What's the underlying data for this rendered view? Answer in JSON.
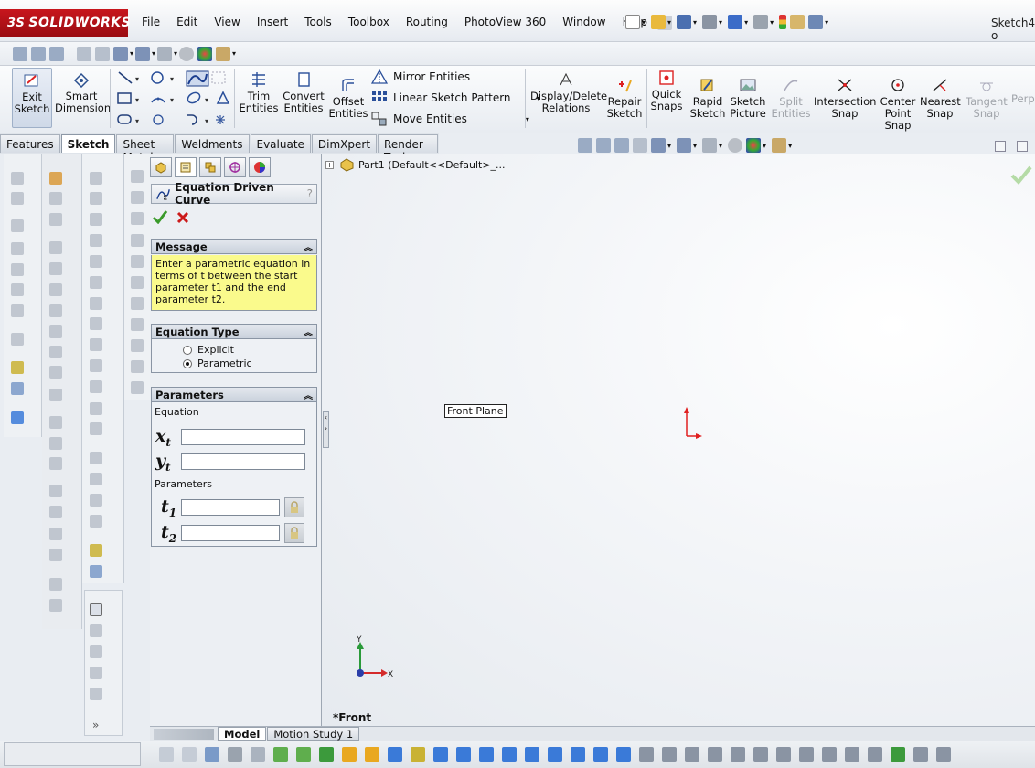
{
  "app": {
    "brand": "SOLIDWORKS",
    "brand_prefix": "3S",
    "document_title": "Sketch4 o"
  },
  "menu": [
    "File",
    "Edit",
    "View",
    "Insert",
    "Tools",
    "Toolbox",
    "Routing",
    "PhotoView 360",
    "Window",
    "Help"
  ],
  "command_manager": {
    "exit_sketch": "Exit Sketch",
    "smart_dimension": "Smart Dimension",
    "trim_entities": "Trim Entities",
    "convert_entities": "Convert Entities",
    "offset_entities": "Offset Entities",
    "mirror_entities": "Mirror Entities",
    "linear_sketch_pattern": "Linear Sketch Pattern",
    "move_entities": "Move Entities",
    "display_delete_relations": "Display/Delete Relations",
    "repair_sketch": "Repair Sketch",
    "quick_snaps": "Quick Snaps",
    "rapid_sketch": "Rapid Sketch",
    "sketch_picture": "Sketch Picture",
    "split_entities": "Split Entities",
    "intersection_snap": "Intersection Snap",
    "center_point_snap": "Center Point Snap",
    "nearest_snap": "Nearest Snap",
    "tangent_snap": "Tangent Snap",
    "perp": "Perp"
  },
  "tabs": [
    "Features",
    "Sketch",
    "Sheet Metal",
    "Weldments",
    "Evaluate",
    "DimXpert",
    "Render Tools"
  ],
  "active_tab": "Sketch",
  "feature_tree": {
    "root": "Part1  (Default<<Default>_..."
  },
  "property_manager": {
    "title": "Equation Driven Curve",
    "message_header": "Message",
    "message_text": "Enter a parametric equation in terms of t between the start parameter t1 and the end parameter t2.",
    "equation_type_header": "Equation Type",
    "equation_type_options": [
      "Explicit",
      "Parametric"
    ],
    "equation_type_selected": "Parametric",
    "parameters_header": "Parameters",
    "equation_label": "Equation",
    "parameters_label": "Parameters",
    "xt_value": "",
    "yt_value": "",
    "t1_value": "",
    "t2_value": ""
  },
  "viewport": {
    "plane_label": "Front Plane",
    "view_name": "*Front",
    "axis_x": "X",
    "axis_y": "Y"
  },
  "bottom_tabs": [
    "Model",
    "Motion Study 1"
  ],
  "active_bottom_tab": "Model",
  "colors": {
    "brand_red": "#c8161d",
    "message_bg": "#fafa8c",
    "origin_red": "#e02020",
    "accept_green": "#3a9a2a",
    "cancel_red": "#cc1a1a"
  }
}
